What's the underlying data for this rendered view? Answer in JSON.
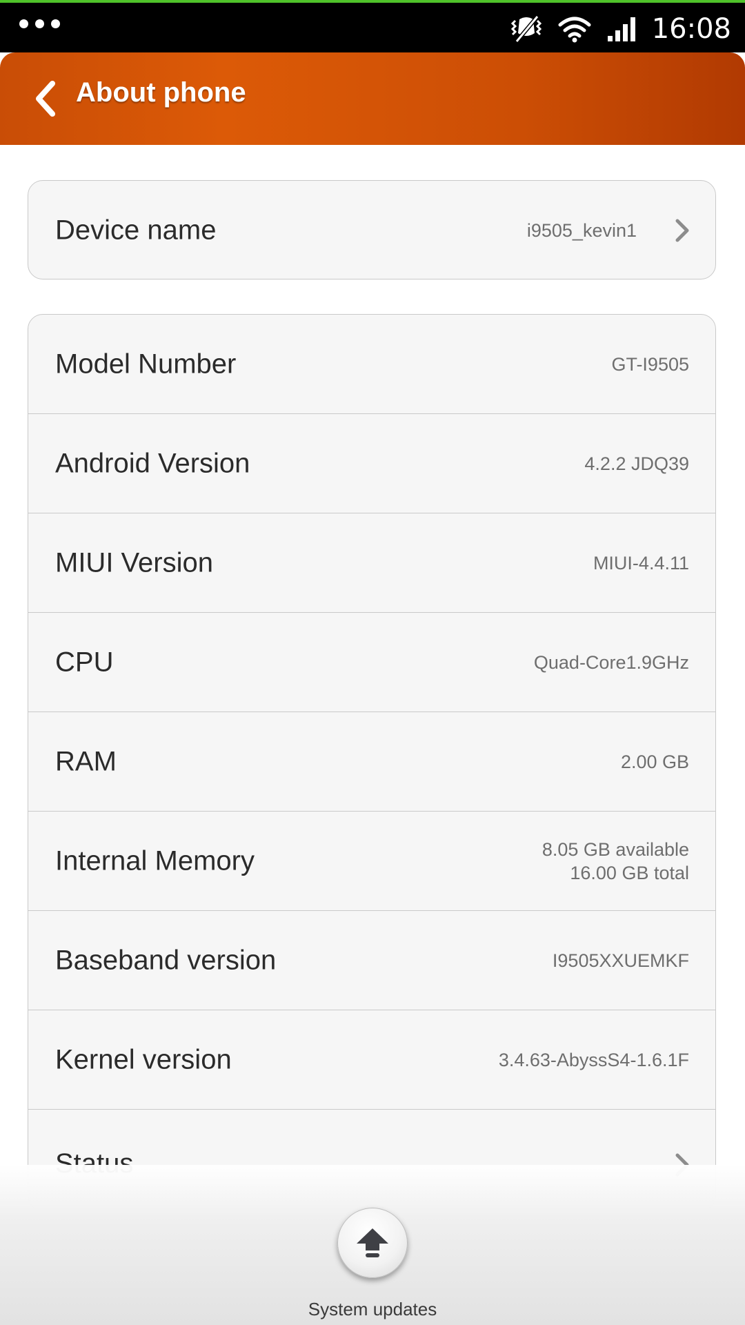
{
  "status_bar": {
    "time": "16:08",
    "icons": [
      "more-dots-icon",
      "vibrate-off-icon",
      "wifi-icon",
      "signal-icon"
    ]
  },
  "header": {
    "title": "About phone",
    "back_icon": "chevron-left-icon",
    "gradient_colors": [
      "#c94d06",
      "#dc5a07",
      "#b13a02"
    ]
  },
  "device": {
    "label": "Device name",
    "value": "i9505_kevin1"
  },
  "info": [
    {
      "label": "Model Number",
      "value": "GT-I9505"
    },
    {
      "label": "Android Version",
      "value": "4.2.2 JDQ39"
    },
    {
      "label": "MIUI Version",
      "value": "MIUI-4.4.11"
    },
    {
      "label": "CPU",
      "value": "Quad-Core1.9GHz"
    },
    {
      "label": "RAM",
      "value": "2.00 GB"
    },
    {
      "label": "Internal Memory",
      "value_line1": "8.05 GB available",
      "value_line2": "16.00 GB total"
    },
    {
      "label": "Baseband version",
      "value": "I9505XXUEMKF"
    },
    {
      "label": "Kernel version",
      "value": "3.4.63-AbyssS4-1.6.1F"
    },
    {
      "label": "Status"
    }
  ],
  "bottom": {
    "update_label": "System updates",
    "update_icon": "arrow-up-icon"
  }
}
